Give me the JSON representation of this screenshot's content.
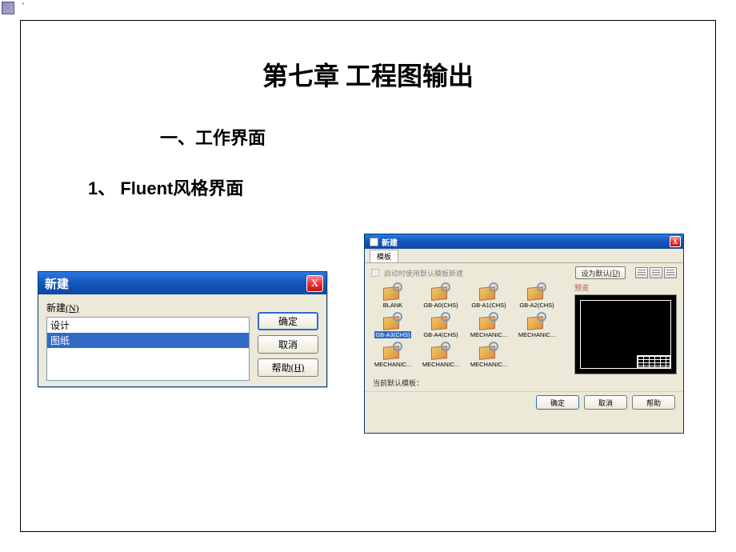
{
  "apostrophe": "'",
  "title": "第七章   工程图输出",
  "section": "一、工作界面",
  "subsection": "1、 Fluent风格界面",
  "dlg1": {
    "title": "新建",
    "close_x": "X",
    "label_prefix": "新建",
    "label_accel": "(N)",
    "items": [
      "设计",
      "图纸"
    ],
    "selected_index": 1,
    "ok": "确定",
    "cancel": "取消",
    "help_prefix": "帮助",
    "help_accel": "(H)"
  },
  "dlg2": {
    "title": "新建",
    "close_x": "X",
    "tab": "模板",
    "disabled_checkbox_label": "启动时使用默认模板新建",
    "set_default_btn_prefix": "设为默认",
    "set_default_btn_accel": "(D)",
    "preview_label": "预览",
    "status_label": "当前默认模板：",
    "status_value": "",
    "templates": [
      {
        "name": "BLANK"
      },
      {
        "name": "GB-A0(CHS)"
      },
      {
        "name": "GB-A1(CHS)"
      },
      {
        "name": "GB-A2(CHS)"
      },
      {
        "name": "GB-A3(CHS)",
        "selected": true
      },
      {
        "name": "GB-A4(CHS)"
      },
      {
        "name": "MECHANIC..."
      },
      {
        "name": "MECHANIC..."
      },
      {
        "name": "MECHANIC..."
      },
      {
        "name": "MECHANIC..."
      },
      {
        "name": "MECHANIC..."
      }
    ],
    "ok": "确定",
    "cancel": "取消",
    "help": "帮助"
  }
}
